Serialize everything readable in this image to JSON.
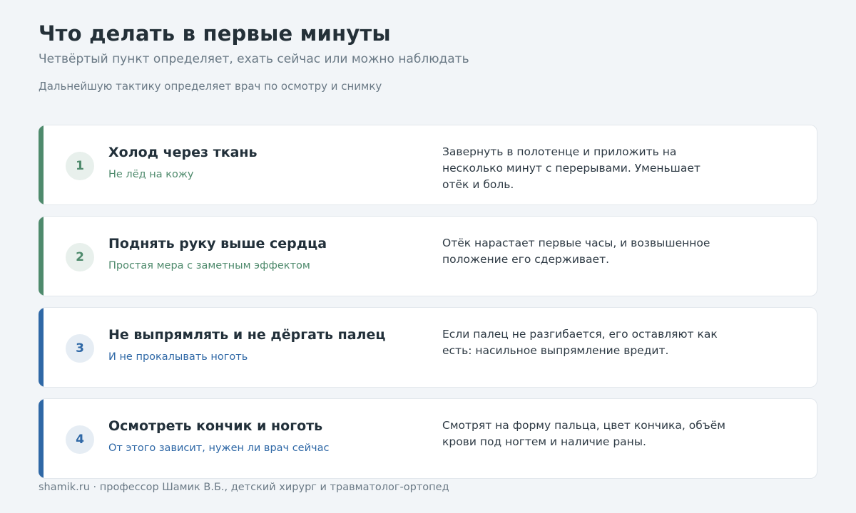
{
  "header": {
    "title": "Что делать в первые минуты",
    "subtitle": "Четвёртый пункт определяет, ехать сейчас или можно наблюдать",
    "note": "Дальнейшую тактику определяет врач по осмотру и снимку"
  },
  "colors": {
    "green": "#4e8a6c",
    "blue": "#2f68a6"
  },
  "steps": [
    {
      "number": "1",
      "title": "Холод через ткань",
      "subtitle": "Не лёд на кожу",
      "description": "Завернуть в полотенце и приложить на несколько минут с перерывами. Уменьшает отёк и боль.",
      "accent": "green"
    },
    {
      "number": "2",
      "title": "Поднять руку выше сердца",
      "subtitle": "Простая мера с заметным эффектом",
      "description": "Отёк нарастает первые часы, и возвышенное положение его сдерживает.",
      "accent": "green"
    },
    {
      "number": "3",
      "title": "Не выпрямлять и не дёргать палец",
      "subtitle": "И не прокалывать ноготь",
      "description": "Если палец не разгибается, его оставляют как есть: насильное выпрямление вредит.",
      "accent": "blue"
    },
    {
      "number": "4",
      "title": "Осмотреть кончик и ноготь",
      "subtitle": "От этого зависит, нужен ли врач сейчас",
      "description": "Смотрят на форму пальца, цвет кончика, объём крови под ногтем и наличие раны.",
      "accent": "blue"
    }
  ],
  "footer": {
    "text": "shamik.ru · профессор Шамик В.Б., детский хирург и травматолог-ортопед"
  }
}
